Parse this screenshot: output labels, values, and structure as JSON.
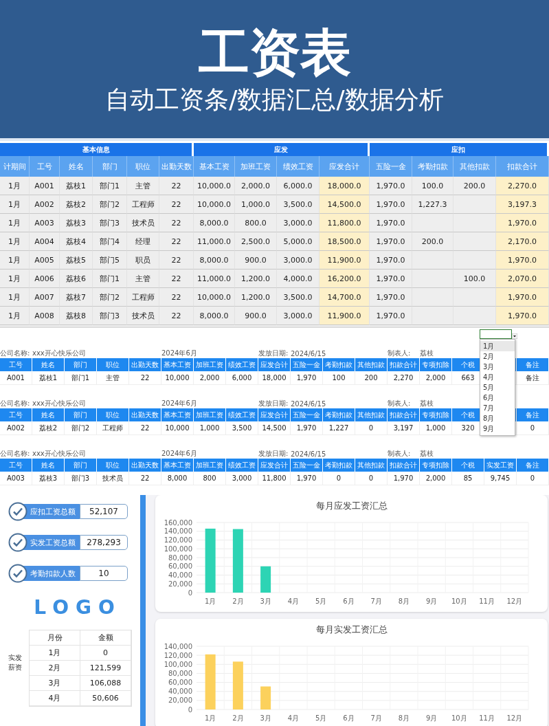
{
  "banner": {
    "title": "工资表",
    "subtitle": "自动工资条/数据汇总/数据分析"
  },
  "salary_table": {
    "groups": [
      {
        "label": "基本信息",
        "columns": [
          {
            "label": "计期间",
            "kind": "plain"
          },
          {
            "label": "工号",
            "kind": "plain"
          },
          {
            "label": "姓名",
            "kind": "plain"
          },
          {
            "label": "部门",
            "kind": "plain"
          },
          {
            "label": "职位",
            "kind": "plain"
          },
          {
            "label": "出勤天数",
            "kind": "plain"
          }
        ]
      },
      {
        "label": "应发",
        "columns": [
          {
            "label": "基本工资",
            "kind": "plain"
          },
          {
            "label": "加班工资",
            "kind": "plain"
          },
          {
            "label": "绩效工资",
            "kind": "plain"
          },
          {
            "label": "应发合计",
            "kind": "total"
          }
        ]
      },
      {
        "label": "应扣",
        "columns": [
          {
            "label": "五险一金",
            "kind": "plain"
          },
          {
            "label": "考勤扣款",
            "kind": "plain"
          },
          {
            "label": "其他扣款",
            "kind": "plain"
          },
          {
            "label": "扣款合计",
            "kind": "total"
          }
        ]
      }
    ],
    "rows": [
      [
        "1月",
        "A001",
        "荔枝1",
        "部门1",
        "主管",
        "22",
        "10,000.0",
        "2,000.0",
        "6,000.0",
        "18,000.0",
        "1,970.0",
        "100.0",
        "200.0",
        "2,270.0"
      ],
      [
        "1月",
        "A002",
        "荔枝2",
        "部门2",
        "工程师",
        "22",
        "10,000.0",
        "1,000.0",
        "3,500.0",
        "14,500.0",
        "1,970.0",
        "1,227.3",
        null,
        "3,197.3"
      ],
      [
        "1月",
        "A003",
        "荔枝3",
        "部门3",
        "技术员",
        "22",
        "8,000.0",
        "800.0",
        "3,000.0",
        "11,800.0",
        "1,970.0",
        null,
        null,
        "1,970.0"
      ],
      [
        "1月",
        "A004",
        "荔枝4",
        "部门4",
        "经理",
        "22",
        "11,000.0",
        "2,500.0",
        "5,000.0",
        "18,500.0",
        "1,970.0",
        "200.0",
        null,
        "2,170.0"
      ],
      [
        "1月",
        "A005",
        "荔枝5",
        "部门5",
        "职员",
        "22",
        "8,000.0",
        "900.0",
        "3,000.0",
        "11,900.0",
        "1,970.0",
        null,
        null,
        "1,970.0"
      ],
      [
        "1月",
        "A006",
        "荔枝6",
        "部门1",
        "主管",
        "22",
        "11,000.0",
        "1,200.0",
        "4,000.0",
        "16,200.0",
        "1,970.0",
        null,
        "100.0",
        "2,070.0"
      ],
      [
        "1月",
        "A007",
        "荔枝7",
        "部门2",
        "工程师",
        "22",
        "10,000.0",
        "1,200.0",
        "3,500.0",
        "14,700.0",
        "1,970.0",
        null,
        null,
        "1,970.0"
      ],
      [
        "1月",
        "A008",
        "荔枝8",
        "部门3",
        "技术员",
        "22",
        "8,000.0",
        "900.0",
        "3,000.0",
        "11,900.0",
        "1,970.0",
        null,
        null,
        "1,970.0"
      ]
    ]
  },
  "payslips": [
    {
      "company_label": "公司名称:",
      "company": "xxx开心快乐公司",
      "period": "2024年6月",
      "date_label": "发放日期:",
      "date": "2024/6/15",
      "maker_label": "制表人:",
      "maker": "荔枝",
      "headers": [
        "工号",
        "姓名",
        "部门",
        "职位",
        "出勤天数",
        "基本工资",
        "加班工资",
        "绩效工资",
        "应发合计",
        "五险一金",
        "考勤扣款",
        "其他扣款",
        "扣款合计",
        "专项扣除",
        "个税",
        {
          "covered": true
        },
        "备注"
      ],
      "values": [
        "A001",
        "荔枝1",
        "部门1",
        "主管",
        "22",
        "10,000",
        "2,000",
        "6,000",
        "18,000",
        "1,970",
        "100",
        "200",
        "2,270",
        "2,000",
        "663",
        {
          "covered": true
        },
        "备注"
      ]
    },
    {
      "company_label": "公司名称:",
      "company": "xxx开心快乐公司",
      "period": "2024年6月",
      "date_label": "发放日期:",
      "date": "2024/6/15",
      "maker_label": "制表人:",
      "maker": "荔枝",
      "headers": [
        "工号",
        "姓名",
        "部门",
        "职位",
        "出勤天数",
        "基本工资",
        "加班工资",
        "绩效工资",
        "应发合计",
        "五险一金",
        "考勤扣款",
        "其他扣款",
        "扣款合计",
        "专项扣除",
        "个税",
        {
          "covered": true
        },
        "备注"
      ],
      "values": [
        "A002",
        "荔枝2",
        "部门2",
        "工程师",
        "22",
        "10,000",
        "1,000",
        "3,500",
        "14,500",
        "1,970",
        "1,227",
        "0",
        "3,197",
        "1,000",
        "320",
        {
          "covered": true
        },
        "0"
      ]
    },
    {
      "company_label": "公司名称:",
      "company": "xxx开心快乐公司",
      "period": "2024年6月",
      "date_label": "发放日期:",
      "date": "2024/6/15",
      "maker_label": "制表人:",
      "maker": "荔枝",
      "headers": [
        "工号",
        "姓名",
        "部门",
        "职位",
        "出勤天数",
        "基本工资",
        "加班工资",
        "绩效工资",
        "应发合计",
        "五险一金",
        "考勤扣款",
        "其他扣款",
        "扣款合计",
        "专项扣除",
        "个税",
        "实发工资",
        "备注"
      ],
      "values": [
        "A003",
        "荔枝3",
        "部门3",
        "技术员",
        "22",
        "8,000",
        "800",
        "3,000",
        "11,800",
        "1,970",
        "0",
        "0",
        "1,970",
        "2,000",
        "85",
        "9,745",
        "0"
      ]
    }
  ],
  "month_dropdown": {
    "options": [
      {
        "label": "1月",
        "selected": true
      },
      {
        "label": "2月",
        "selected": false
      },
      {
        "label": "3月",
        "selected": false
      },
      {
        "label": "4月",
        "selected": false
      },
      {
        "label": "5月",
        "selected": false
      },
      {
        "label": "6月",
        "selected": false
      },
      {
        "label": "7月",
        "selected": false
      },
      {
        "label": "8月",
        "selected": false
      },
      {
        "label": "9月",
        "selected": false
      }
    ]
  },
  "dashboard": {
    "stats": [
      {
        "label": "应扣工资总额",
        "value": "52,107"
      },
      {
        "label": "实发工资总额",
        "value": "278,293"
      },
      {
        "label": "考勤扣款人数",
        "value": "10"
      }
    ],
    "logo": "LOGO",
    "pay_table": {
      "label": "实发薪资",
      "columns": [
        "月份",
        "金额"
      ],
      "rows": [
        [
          "1月",
          "0"
        ],
        [
          "2月",
          "121,599"
        ],
        [
          "3月",
          "106,088"
        ],
        [
          "4月",
          "50,606"
        ]
      ]
    },
    "charts": [
      {
        "chart_data": {
          "type": "bar",
          "title": "每月应发工资汇总",
          "categories": [
            "1月",
            "2月",
            "3月",
            "4月",
            "5月",
            "6月",
            "7月",
            "8月",
            "9月",
            "10月",
            "11月",
            "12月"
          ],
          "grid": true,
          "series": [
            {
              "color": "#2dd4b4",
              "values": [
                146000,
                145000,
                60000,
                null,
                null,
                null,
                null,
                null,
                null,
                null,
                null,
                null
              ]
            }
          ],
          "ylim": [
            0,
            160000
          ],
          "yticks": [
            0,
            {
              "value": 20000,
              "label": "20,000"
            },
            {
              "value": 40000,
              "label": "40,000"
            },
            {
              "value": 60000,
              "label": "60,000"
            },
            {
              "value": 80000,
              "label": "80,000"
            },
            {
              "value": 100000,
              "label": "100,000"
            },
            {
              "value": 120000,
              "label": "120,000"
            },
            {
              "value": 140000,
              "label": "140,000"
            },
            {
              "value": 160000,
              "label": "160,000"
            }
          ]
        }
      },
      {
        "chart_data": {
          "type": "bar",
          "title": "每月实发工资汇总",
          "categories": [
            "1月",
            "2月",
            "3月",
            "4月",
            "5月",
            "6月",
            "7月",
            "8月",
            "9月",
            "10月",
            "11月",
            "12月"
          ],
          "grid": true,
          "series": [
            {
              "color": "#fcd15c",
              "values": [
                122000,
                106000,
                51000,
                null,
                null,
                null,
                null,
                null,
                null,
                null,
                null,
                null
              ]
            }
          ],
          "ylim": [
            0,
            140000
          ],
          "yticks": [
            0,
            {
              "value": 20000,
              "label": "20,000"
            },
            {
              "value": 40000,
              "label": "40,000"
            },
            {
              "value": 60000,
              "label": "60,000"
            },
            {
              "value": 80000,
              "label": "80,000"
            },
            {
              "value": 100000,
              "label": "100,000"
            },
            {
              "value": 120000,
              "label": "120,000"
            },
            {
              "value": 140000,
              "label": "140,000"
            }
          ]
        }
      }
    ]
  }
}
